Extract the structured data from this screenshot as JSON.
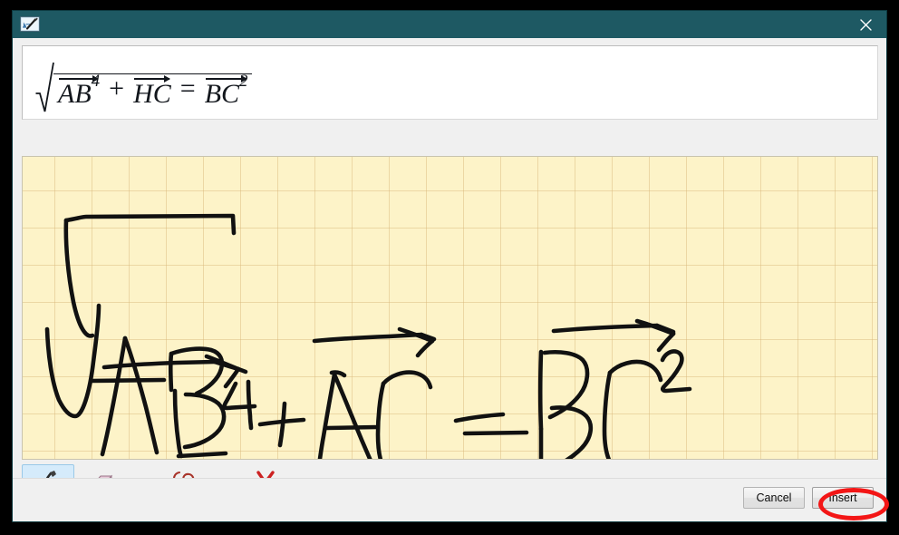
{
  "window": {
    "title": "",
    "icon": "math-input-panel-icon",
    "close_label": "×"
  },
  "preview": {
    "description": "Recognized math expression preview",
    "expression": "√(AB⃗⁴ + HC⃗ = BC⃗²)",
    "terms": [
      {
        "base": "AB",
        "sup": "4",
        "vector": true
      },
      {
        "op": "+"
      },
      {
        "base": "HC",
        "sup": "",
        "vector": true
      },
      {
        "op": "="
      },
      {
        "base": "BC",
        "sup": "2",
        "vector": true
      }
    ],
    "term1_base": "AB",
    "term1_sup": "4",
    "op1": "+",
    "term2_base": "HC",
    "term2_sup": "",
    "op2": "=",
    "term3_base": "BC",
    "term3_sup": "2"
  },
  "canvas": {
    "name": "handwriting-input-area",
    "background_color": "#fdf3c8",
    "grid_color": "#d8b678",
    "ink_color": "#111111",
    "written_expression": "√(AB⃗⁴ + AC⃗ = BC⃗²)"
  },
  "toolbar": {
    "items": [
      {
        "label": "Write",
        "icon": "pen-icon",
        "selected": true
      },
      {
        "label": "Erase",
        "icon": "eraser-icon",
        "selected": false
      },
      {
        "label": "Select and Correct",
        "icon": "lasso-icon",
        "selected": false
      },
      {
        "label": "Clear",
        "icon": "red-x-icon",
        "selected": false
      }
    ]
  },
  "footer": {
    "cancel_label": "Cancel",
    "insert_label": "Insert"
  },
  "annotation": {
    "highlight_color": "#f31616",
    "target": "insert-button"
  }
}
